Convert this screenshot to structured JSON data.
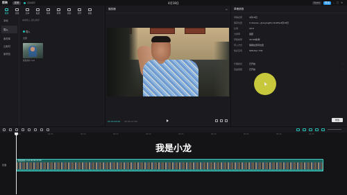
{
  "titlebar": {
    "logo": "剪映",
    "menu_label": "菜单",
    "status": "自动保存",
    "title": "4月18日",
    "right_buttons": [
      "Open",
      "导出"
    ],
    "accent_color": "#2f9cf0"
  },
  "left_panel": {
    "tools": [
      {
        "label": "媒体",
        "icon": "media-icon",
        "active": true
      },
      {
        "label": "音频",
        "icon": "audio-icon",
        "active": false
      },
      {
        "label": "文本",
        "icon": "text-icon",
        "active": false
      },
      {
        "label": "贴纸",
        "icon": "sticker-icon",
        "active": false
      },
      {
        "label": "特效",
        "icon": "effects-icon",
        "active": false
      },
      {
        "label": "转场",
        "icon": "transition-icon",
        "active": false
      },
      {
        "label": "滤镜",
        "icon": "filter-icon",
        "active": false
      },
      {
        "label": "调节",
        "icon": "adjust-icon",
        "active": false
      },
      {
        "label": "模板",
        "icon": "template-icon",
        "active": false
      }
    ],
    "categories": [
      "本地",
      "导入",
      "素材库",
      "云素材",
      "素材包"
    ],
    "active_category": "导入",
    "search_placeholder": "本地导入  默认排序",
    "import_label": "导入",
    "sub_label": "全部",
    "media_item_name": "视频素材.mp4"
  },
  "player": {
    "title": "播放器",
    "current_time": "00:00:00:00",
    "total_time": "00:00:47:06"
  },
  "props": {
    "title": "草稿参数",
    "rows": [
      {
        "key": "草稿名称",
        "value": "4月18日",
        "chev": false
      },
      {
        "key": "保存位置",
        "value": "C:/Users/.../JianyingPro Drafts/4月18日",
        "chev": false
      },
      {
        "key": "比例",
        "value": "16:9",
        "chev": false
      },
      {
        "key": "分辨率",
        "value": "适配",
        "chev": false
      },
      {
        "key": "草稿帧率",
        "value": "30.00帧/秒",
        "chev": false
      },
      {
        "key": "导入方式",
        "value": "保留在原有位置",
        "chev": false
      },
      {
        "key": "色彩空间",
        "value": "SDR-Rec.709",
        "chev": false
      },
      {
        "key": "代理模式",
        "value": "已开启",
        "chev": true
      },
      {
        "key": "自由层级",
        "value": "已开启",
        "chev": true
      }
    ],
    "modify_label": "修改",
    "cursor_color": "#d7d740"
  },
  "timeline": {
    "caption": "我是小龙",
    "track_label": "封面",
    "clip_name": "视频素材.mp4  00:00:47:06",
    "ruler_ticks": [
      "00:00",
      "00:05",
      "00:10",
      "00:15",
      "00:20",
      "00:25",
      "00:30",
      "00:35",
      "00:40",
      "00:45"
    ],
    "accent_color": "#26c0b8"
  }
}
